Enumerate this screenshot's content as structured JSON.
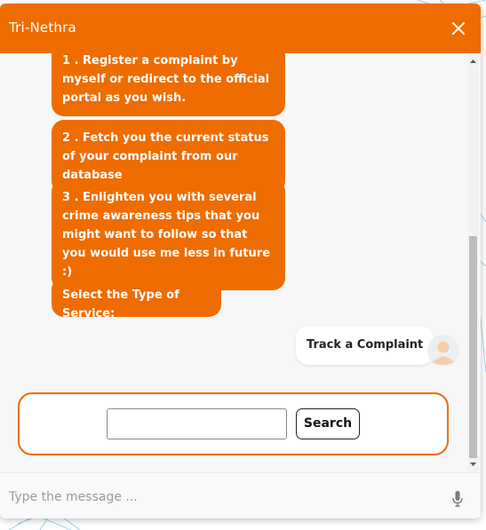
{
  "header": {
    "title": "Tri-Nethra",
    "close_icon": "close-icon"
  },
  "messages": {
    "bot": [
      "1 . Register a complaint by myself or redirect to the official portal as you wish.",
      "2 . Fetch you the current status of your complaint from our database",
      "3 . Enlighten you with several crime awareness tips that you might want to follow so that you would use me less in future :)",
      "Select the Type of Service:"
    ],
    "user": "Track a Complaint"
  },
  "search": {
    "input_value": "",
    "button_label": "Search"
  },
  "composer": {
    "placeholder": "Type the message ...",
    "mic_icon": "microphone-icon"
  },
  "colors": {
    "accent": "#ef6c00",
    "background": "#f6f7f9",
    "user_bubble": "#ffffff"
  }
}
